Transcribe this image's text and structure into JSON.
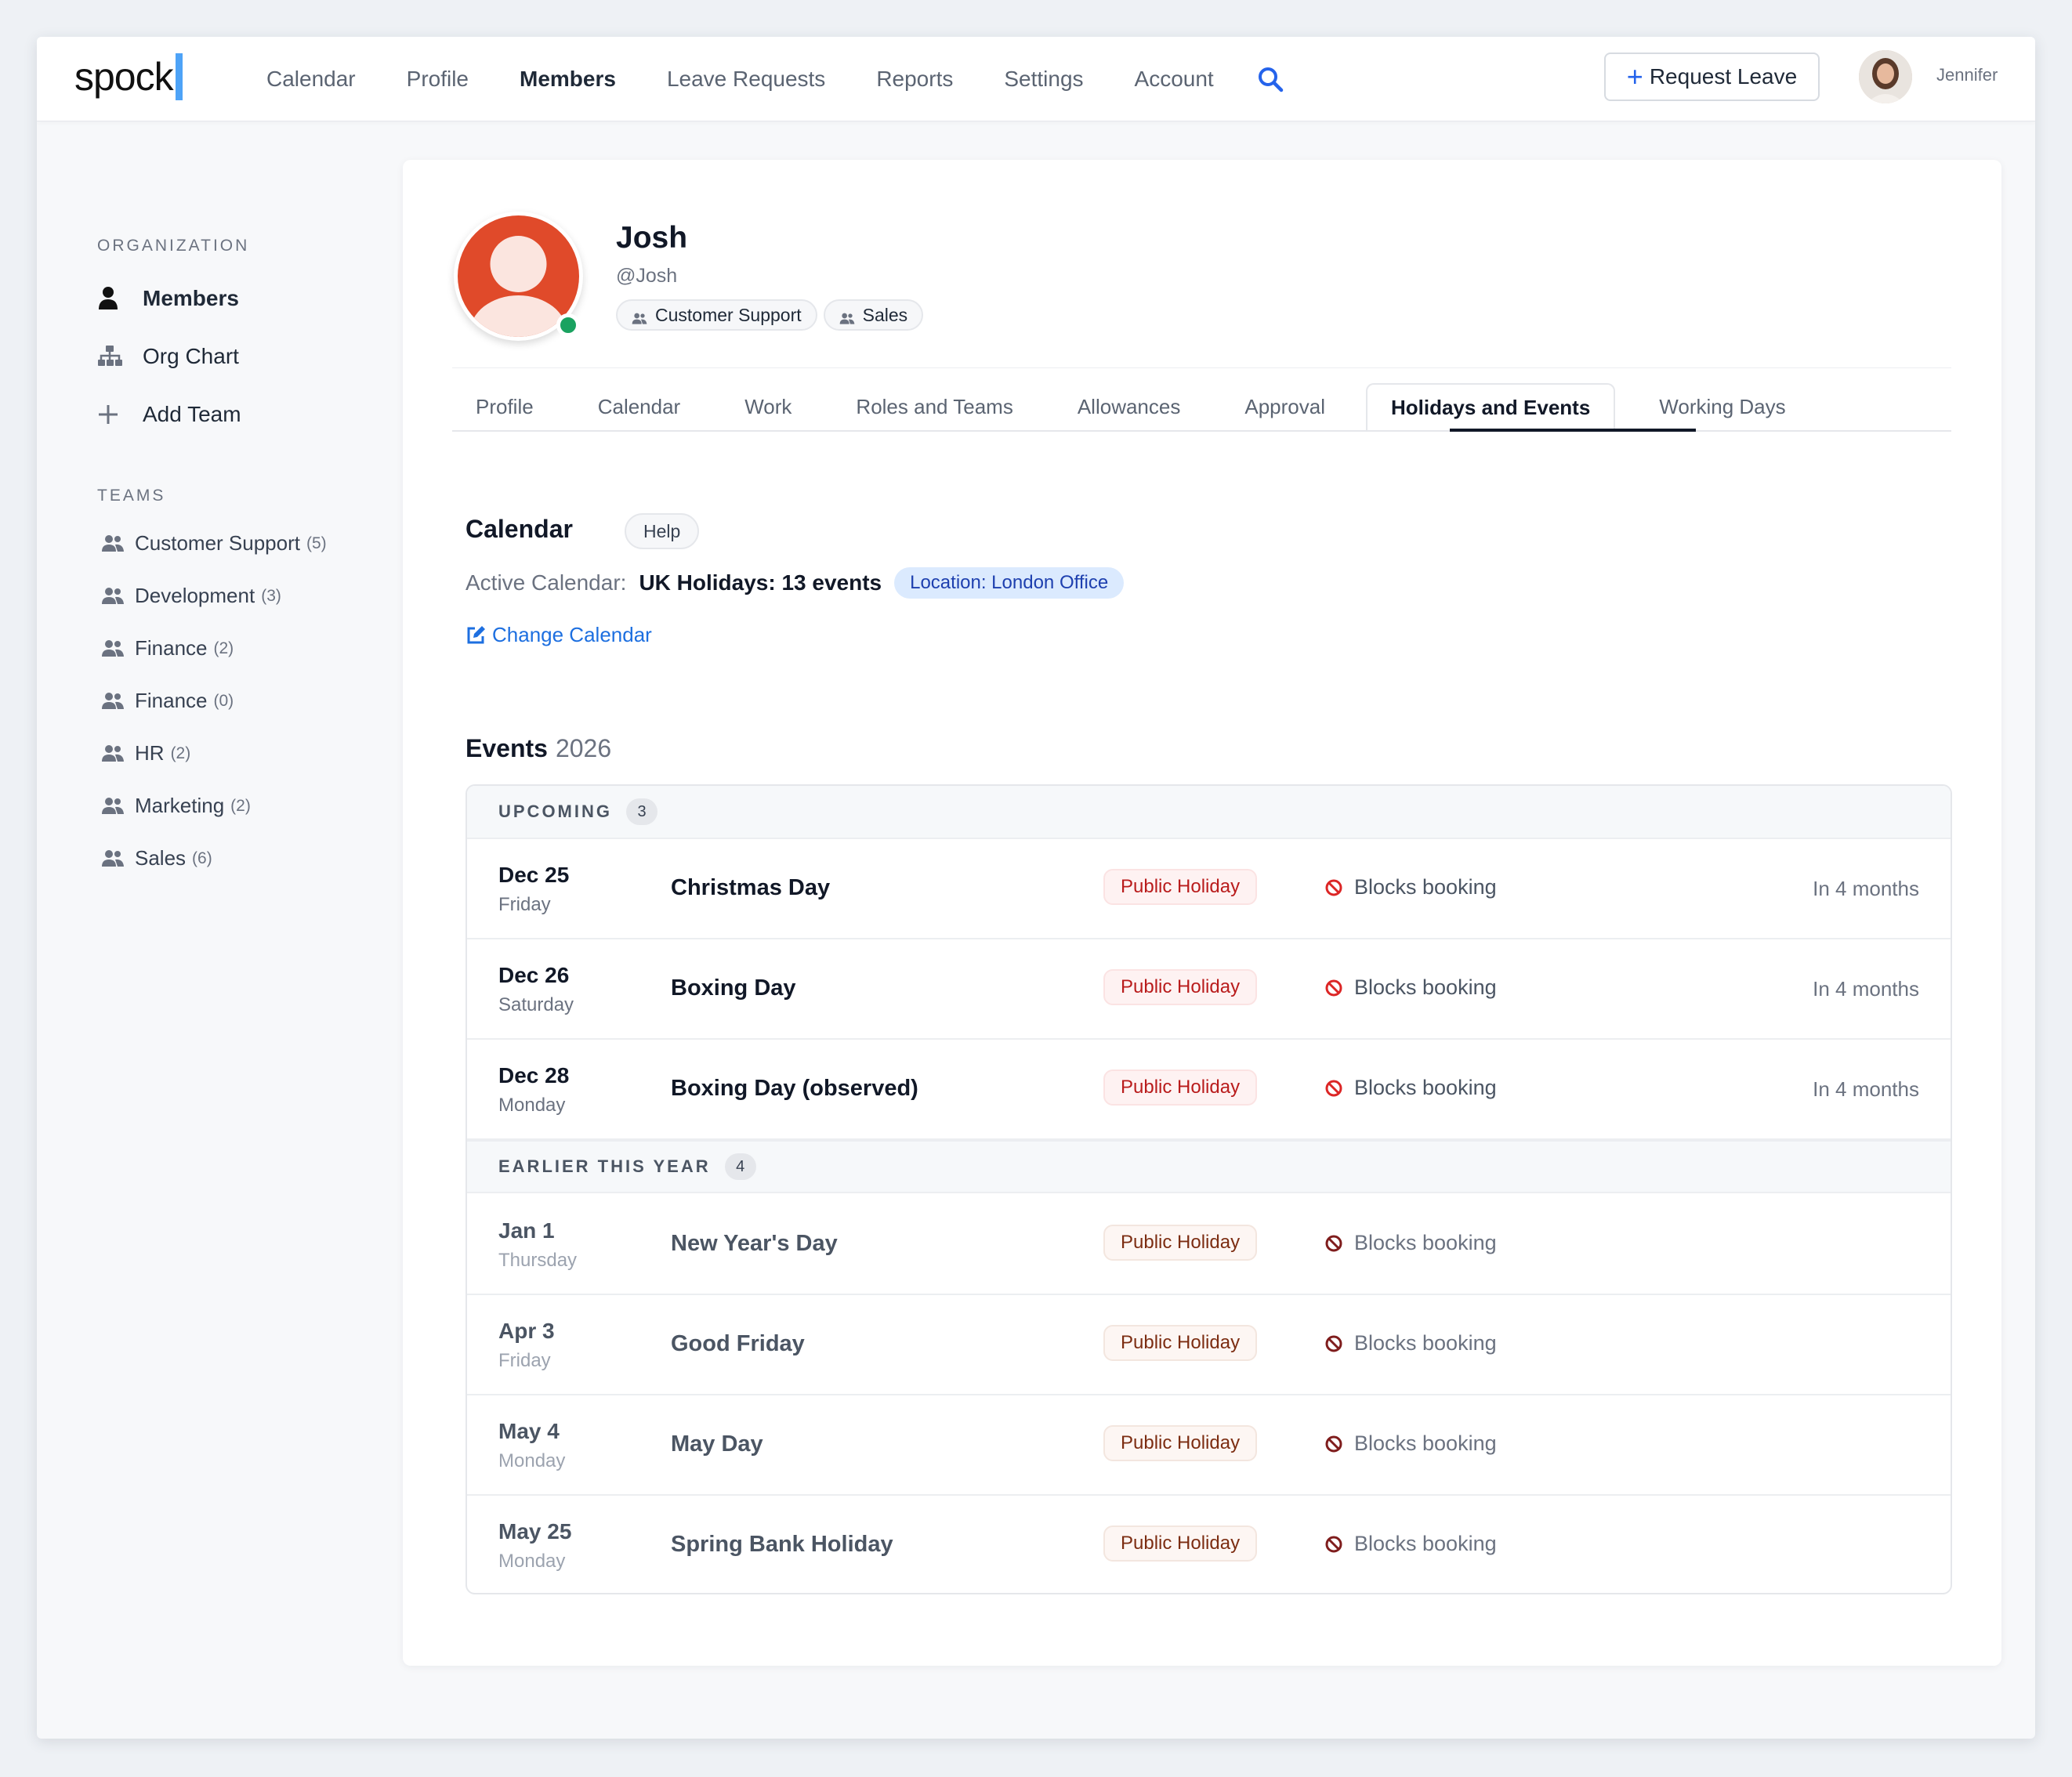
{
  "topnav": {
    "logo": "spock",
    "links": [
      "Calendar",
      "Profile",
      "Members",
      "Leave Requests",
      "Reports",
      "Settings",
      "Account"
    ],
    "active_link": "Members",
    "request_leave_label": "Request Leave",
    "user_name": "Jennifer"
  },
  "sidebar": {
    "org_heading": "ORGANIZATION",
    "org_items": [
      {
        "label": "Members",
        "icon": "person-icon"
      },
      {
        "label": "Org Chart",
        "icon": "org-chart-icon"
      },
      {
        "label": "Add Team",
        "icon": "plus-icon"
      }
    ],
    "teams_heading": "TEAMS",
    "teams": [
      {
        "name": "Customer Support",
        "count": "(5)"
      },
      {
        "name": "Development",
        "count": "(3)"
      },
      {
        "name": "Finance",
        "count": "(2)"
      },
      {
        "name": "Finance",
        "count": "(0)"
      },
      {
        "name": "HR",
        "count": "(2)"
      },
      {
        "name": "Marketing",
        "count": "(2)"
      },
      {
        "name": "Sales",
        "count": "(6)"
      }
    ]
  },
  "profile": {
    "name": "Josh",
    "handle": "@Josh",
    "tags": [
      "Customer Support",
      "Sales"
    ],
    "avatar_color": "#e04a2a",
    "status_color": "#1aa260"
  },
  "tabs": {
    "items": [
      "Profile",
      "Calendar",
      "Work",
      "Roles and Teams",
      "Allowances",
      "Approval",
      "Holidays and Events",
      "Working Days"
    ],
    "active": "Holidays and Events"
  },
  "calendar": {
    "title": "Calendar",
    "help_label": "Help",
    "active_label": "Active Calendar:",
    "active_value": "UK Holidays: 13 events",
    "location_badge": "Location: London Office",
    "change_label": "Change Calendar"
  },
  "events": {
    "title": "Events",
    "year": "2026",
    "upcoming_label": "UPCOMING",
    "upcoming_count": "3",
    "earlier_label": "EARLIER THIS YEAR",
    "earlier_count": "4",
    "upcoming": [
      {
        "date": "Dec 25",
        "day": "Friday",
        "name": "Christmas Day",
        "type": "Public Holiday",
        "blocks": "Blocks booking",
        "when": "In 4 months"
      },
      {
        "date": "Dec 26",
        "day": "Saturday",
        "name": "Boxing Day",
        "type": "Public Holiday",
        "blocks": "Blocks booking",
        "when": "In 4 months"
      },
      {
        "date": "Dec 28",
        "day": "Monday",
        "name": "Boxing Day (observed)",
        "type": "Public Holiday",
        "blocks": "Blocks booking",
        "when": "In 4 months"
      }
    ],
    "earlier": [
      {
        "date": "Jan 1",
        "day": "Thursday",
        "name": "New Year's Day",
        "type": "Public Holiday",
        "blocks": "Blocks booking"
      },
      {
        "date": "Apr 3",
        "day": "Friday",
        "name": "Good Friday",
        "type": "Public Holiday",
        "blocks": "Blocks booking"
      },
      {
        "date": "May 4",
        "day": "Monday",
        "name": "May Day",
        "type": "Public Holiday",
        "blocks": "Blocks booking"
      },
      {
        "date": "May 25",
        "day": "Monday",
        "name": "Spring Bank Holiday",
        "type": "Public Holiday",
        "blocks": "Blocks booking"
      }
    ]
  }
}
